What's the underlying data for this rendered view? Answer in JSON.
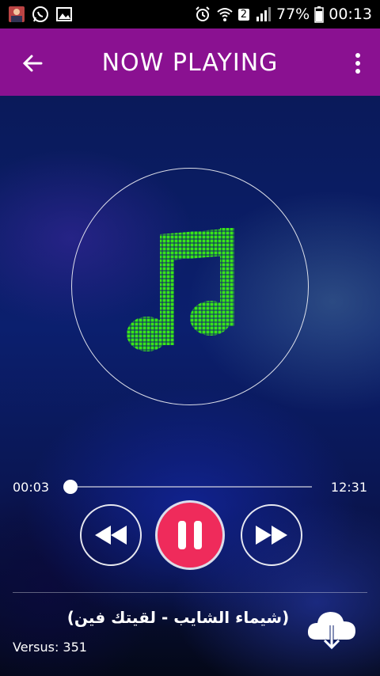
{
  "status_bar": {
    "battery": "77%",
    "time": "00:13",
    "sim_badge": "2",
    "icons": [
      "contact-avatar",
      "whatsapp-icon",
      "image-icon",
      "alarm-icon",
      "wifi-icon",
      "signal-icon",
      "battery-icon"
    ]
  },
  "app_bar": {
    "title": "NOW PLAYING",
    "color": "#8a1191"
  },
  "player": {
    "current_time": "00:03",
    "total_time": "12:31",
    "progress": 0.004,
    "accent_color": "#ef2b5b",
    "note_color": "#39e619"
  },
  "track": {
    "title": "(شيماء الشايب - لقيتك فين)",
    "version": "Versus: 351"
  }
}
